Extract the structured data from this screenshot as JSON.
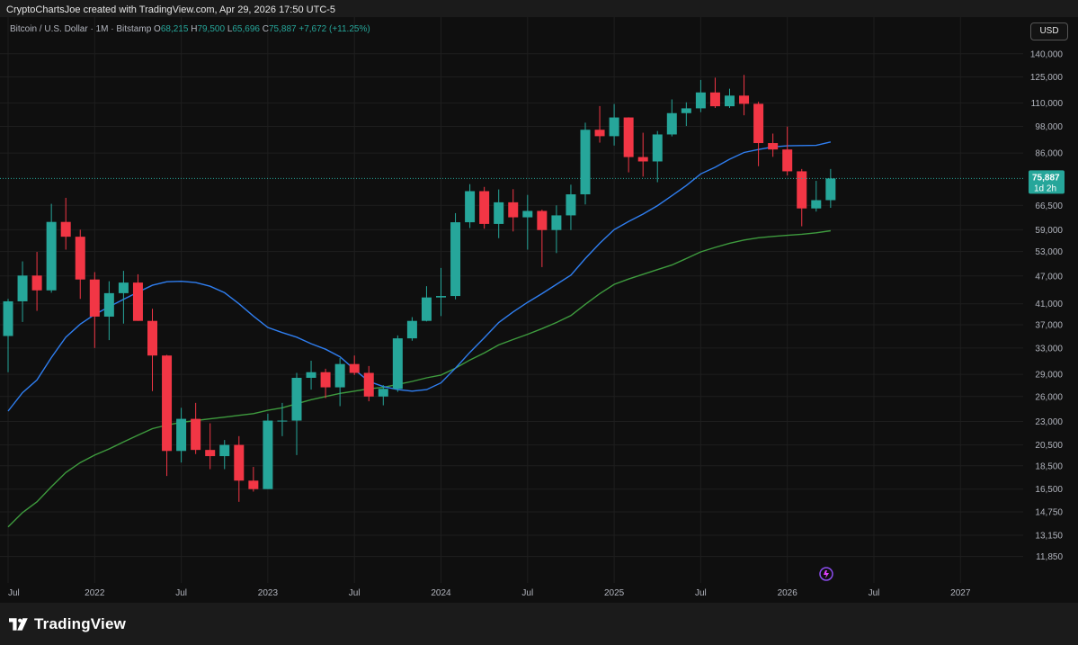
{
  "header": {
    "attribution": "CryptoChartsJoe created with TradingView.com, Apr 29, 2026 17:50 UTC-5"
  },
  "legend": {
    "symbol": "Bitcoin / U.S. Dollar · 1M · Bitstamp",
    "o_label": "O",
    "o_value": "68,215",
    "h_label": "H",
    "h_value": "79,500",
    "l_label": "L",
    "l_value": "65,696",
    "c_label": "C",
    "c_value": "75,887",
    "change": "+7,672 (+11.25%)"
  },
  "currency_button": "USD",
  "price_tag": {
    "value": "75,887",
    "countdown": "1d 2h"
  },
  "footer": {
    "brand": "TradingView"
  },
  "colors": {
    "up": "#26a69a",
    "down": "#f23645",
    "ma_fast": "#2f7ef0",
    "ma_slow": "#3e9b3e",
    "background": "#0f0f0f"
  },
  "chart_data": {
    "type": "candlestick",
    "scale": "log",
    "y_ticks": [
      11850,
      13150,
      14750,
      16500,
      18500,
      20500,
      23000,
      26000,
      29000,
      33000,
      37000,
      41000,
      47000,
      53000,
      59000,
      66500,
      75887,
      86000,
      98000,
      110000,
      125000,
      140000
    ],
    "y_tick_labels": [
      "11,850",
      "13,150",
      "14,750",
      "16,500",
      "18,500",
      "20,500",
      "23,000",
      "26,000",
      "29,000",
      "33,000",
      "37,000",
      "41,000",
      "47,000",
      "53,000",
      "59,000",
      "66,500",
      "75,887",
      "86,000",
      "98,000",
      "110,000",
      "125,000",
      "140,000"
    ],
    "x_ticks": [
      {
        "label": "Jul",
        "month": "2021-07"
      },
      {
        "label": "2022",
        "month": "2022-01"
      },
      {
        "label": "Jul",
        "month": "2022-07"
      },
      {
        "label": "2023",
        "month": "2023-01"
      },
      {
        "label": "Jul",
        "month": "2023-07"
      },
      {
        "label": "2024",
        "month": "2024-01"
      },
      {
        "label": "Jul",
        "month": "2024-07"
      },
      {
        "label": "2025",
        "month": "2025-01"
      },
      {
        "label": "Jul",
        "month": "2025-07"
      },
      {
        "label": "2026",
        "month": "2026-01"
      },
      {
        "label": "Jul",
        "month": "2026-07"
      },
      {
        "label": "2027",
        "month": "2027-01"
      }
    ],
    "candles": [
      {
        "month": "2021-07",
        "o": 35000,
        "h": 42000,
        "l": 29300,
        "c": 41500
      },
      {
        "month": "2021-08",
        "o": 41500,
        "h": 50500,
        "l": 37500,
        "c": 47100
      },
      {
        "month": "2021-09",
        "o": 47100,
        "h": 52900,
        "l": 39600,
        "c": 43800
      },
      {
        "month": "2021-10",
        "o": 43800,
        "h": 67000,
        "l": 43300,
        "c": 61300
      },
      {
        "month": "2021-11",
        "o": 61300,
        "h": 69000,
        "l": 53500,
        "c": 57000
      },
      {
        "month": "2021-12",
        "o": 57000,
        "h": 59000,
        "l": 42000,
        "c": 46200
      },
      {
        "month": "2022-01",
        "o": 46200,
        "h": 47900,
        "l": 33000,
        "c": 38500
      },
      {
        "month": "2022-02",
        "o": 38500,
        "h": 45800,
        "l": 34300,
        "c": 43200
      },
      {
        "month": "2022-03",
        "o": 43200,
        "h": 48200,
        "l": 37200,
        "c": 45500
      },
      {
        "month": "2022-04",
        "o": 45500,
        "h": 47400,
        "l": 37700,
        "c": 37700
      },
      {
        "month": "2022-05",
        "o": 37700,
        "h": 40000,
        "l": 26700,
        "c": 31800
      },
      {
        "month": "2022-06",
        "o": 31800,
        "h": 31900,
        "l": 17600,
        "c": 19900
      },
      {
        "month": "2022-07",
        "o": 19900,
        "h": 24600,
        "l": 18800,
        "c": 23300
      },
      {
        "month": "2022-08",
        "o": 23300,
        "h": 25200,
        "l": 19600,
        "c": 20000
      },
      {
        "month": "2022-09",
        "o": 20000,
        "h": 22800,
        "l": 18200,
        "c": 19400
      },
      {
        "month": "2022-10",
        "o": 19400,
        "h": 21000,
        "l": 18200,
        "c": 20500
      },
      {
        "month": "2022-11",
        "o": 20500,
        "h": 21400,
        "l": 15500,
        "c": 17200
      },
      {
        "month": "2022-12",
        "o": 17200,
        "h": 18400,
        "l": 16300,
        "c": 16500
      },
      {
        "month": "2023-01",
        "o": 16500,
        "h": 23900,
        "l": 16500,
        "c": 23100
      },
      {
        "month": "2023-02",
        "o": 23100,
        "h": 25200,
        "l": 21400,
        "c": 23100
      },
      {
        "month": "2023-03",
        "o": 23100,
        "h": 29200,
        "l": 19500,
        "c": 28500
      },
      {
        "month": "2023-04",
        "o": 28500,
        "h": 31000,
        "l": 26900,
        "c": 29300
      },
      {
        "month": "2023-05",
        "o": 29300,
        "h": 29800,
        "l": 25800,
        "c": 27200
      },
      {
        "month": "2023-06",
        "o": 27200,
        "h": 31400,
        "l": 24800,
        "c": 30500
      },
      {
        "month": "2023-07",
        "o": 30500,
        "h": 31800,
        "l": 28900,
        "c": 29200
      },
      {
        "month": "2023-08",
        "o": 29200,
        "h": 30200,
        "l": 25400,
        "c": 26000
      },
      {
        "month": "2023-09",
        "o": 26000,
        "h": 27500,
        "l": 24900,
        "c": 27000
      },
      {
        "month": "2023-10",
        "o": 27000,
        "h": 35100,
        "l": 26600,
        "c": 34600
      },
      {
        "month": "2023-11",
        "o": 34600,
        "h": 38400,
        "l": 34200,
        "c": 37700
      },
      {
        "month": "2023-12",
        "o": 37700,
        "h": 44700,
        "l": 37600,
        "c": 42300
      },
      {
        "month": "2024-01",
        "o": 42300,
        "h": 48900,
        "l": 38600,
        "c": 42600
      },
      {
        "month": "2024-02",
        "o": 42600,
        "h": 64000,
        "l": 41900,
        "c": 61200
      },
      {
        "month": "2024-03",
        "o": 61200,
        "h": 73800,
        "l": 59500,
        "c": 71300
      },
      {
        "month": "2024-04",
        "o": 71300,
        "h": 72800,
        "l": 59300,
        "c": 60700
      },
      {
        "month": "2024-05",
        "o": 60700,
        "h": 71900,
        "l": 56600,
        "c": 67500
      },
      {
        "month": "2024-06",
        "o": 67500,
        "h": 72000,
        "l": 58500,
        "c": 62700
      },
      {
        "month": "2024-07",
        "o": 62700,
        "h": 70000,
        "l": 53500,
        "c": 64700
      },
      {
        "month": "2024-08",
        "o": 64700,
        "h": 65100,
        "l": 49100,
        "c": 58900
      },
      {
        "month": "2024-09",
        "o": 58900,
        "h": 66500,
        "l": 52600,
        "c": 63300
      },
      {
        "month": "2024-10",
        "o": 63300,
        "h": 73600,
        "l": 58900,
        "c": 70200
      },
      {
        "month": "2024-11",
        "o": 70200,
        "h": 99800,
        "l": 66800,
        "c": 96400
      },
      {
        "month": "2024-12",
        "o": 96400,
        "h": 108300,
        "l": 90500,
        "c": 93400
      },
      {
        "month": "2025-01",
        "o": 93400,
        "h": 109400,
        "l": 89200,
        "c": 102400
      },
      {
        "month": "2025-02",
        "o": 102400,
        "h": 102500,
        "l": 78200,
        "c": 84300
      },
      {
        "month": "2025-03",
        "o": 84300,
        "h": 95000,
        "l": 76600,
        "c": 82500
      },
      {
        "month": "2025-04",
        "o": 82500,
        "h": 95800,
        "l": 74500,
        "c": 94200
      },
      {
        "month": "2025-05",
        "o": 94200,
        "h": 111900,
        "l": 93300,
        "c": 104600
      },
      {
        "month": "2025-06",
        "o": 104600,
        "h": 110300,
        "l": 98200,
        "c": 107100
      },
      {
        "month": "2025-07",
        "o": 107100,
        "h": 123100,
        "l": 105100,
        "c": 115800
      },
      {
        "month": "2025-08",
        "o": 115800,
        "h": 124500,
        "l": 107300,
        "c": 108200
      },
      {
        "month": "2025-09",
        "o": 108200,
        "h": 117900,
        "l": 107300,
        "c": 114000
      },
      {
        "month": "2025-10",
        "o": 114000,
        "h": 126200,
        "l": 103500,
        "c": 109500
      },
      {
        "month": "2025-11",
        "o": 109500,
        "h": 110600,
        "l": 80600,
        "c": 90300
      },
      {
        "month": "2025-12",
        "o": 90300,
        "h": 94600,
        "l": 84400,
        "c": 87500
      },
      {
        "month": "2026-01",
        "o": 87500,
        "h": 97900,
        "l": 77000,
        "c": 78600
      },
      {
        "month": "2026-02",
        "o": 78600,
        "h": 79500,
        "l": 60000,
        "c": 65500
      },
      {
        "month": "2026-03",
        "o": 65500,
        "h": 75000,
        "l": 64500,
        "c": 68215
      },
      {
        "month": "2026-04",
        "o": 68215,
        "h": 79500,
        "l": 65696,
        "c": 75887
      }
    ],
    "ma_fast": [
      {
        "month": "2021-07",
        "v": 24200
      },
      {
        "month": "2021-08",
        "v": 26500
      },
      {
        "month": "2021-09",
        "v": 28200
      },
      {
        "month": "2021-10",
        "v": 31500
      },
      {
        "month": "2021-11",
        "v": 34800
      },
      {
        "month": "2021-12",
        "v": 37100
      },
      {
        "month": "2022-01",
        "v": 38900
      },
      {
        "month": "2022-02",
        "v": 40400
      },
      {
        "month": "2022-03",
        "v": 41900
      },
      {
        "month": "2022-04",
        "v": 43400
      },
      {
        "month": "2022-05",
        "v": 44900
      },
      {
        "month": "2022-06",
        "v": 45700
      },
      {
        "month": "2022-07",
        "v": 45800
      },
      {
        "month": "2022-08",
        "v": 45500
      },
      {
        "month": "2022-09",
        "v": 44700
      },
      {
        "month": "2022-10",
        "v": 43300
      },
      {
        "month": "2022-11",
        "v": 41000
      },
      {
        "month": "2022-12",
        "v": 38600
      },
      {
        "month": "2023-01",
        "v": 36500
      },
      {
        "month": "2023-02",
        "v": 35600
      },
      {
        "month": "2023-03",
        "v": 34800
      },
      {
        "month": "2023-04",
        "v": 33700
      },
      {
        "month": "2023-05",
        "v": 32800
      },
      {
        "month": "2023-06",
        "v": 31600
      },
      {
        "month": "2023-07",
        "v": 29700
      },
      {
        "month": "2023-08",
        "v": 28000
      },
      {
        "month": "2023-09",
        "v": 27300
      },
      {
        "month": "2023-10",
        "v": 26900
      },
      {
        "month": "2023-11",
        "v": 26700
      },
      {
        "month": "2023-12",
        "v": 26900
      },
      {
        "month": "2024-01",
        "v": 27800
      },
      {
        "month": "2024-02",
        "v": 29900
      },
      {
        "month": "2024-03",
        "v": 32300
      },
      {
        "month": "2024-04",
        "v": 34700
      },
      {
        "month": "2024-05",
        "v": 37400
      },
      {
        "month": "2024-06",
        "v": 39400
      },
      {
        "month": "2024-07",
        "v": 41300
      },
      {
        "month": "2024-08",
        "v": 43100
      },
      {
        "month": "2024-09",
        "v": 45100
      },
      {
        "month": "2024-10",
        "v": 47200
      },
      {
        "month": "2024-11",
        "v": 51200
      },
      {
        "month": "2024-12",
        "v": 55200
      },
      {
        "month": "2025-01",
        "v": 59000
      },
      {
        "month": "2025-02",
        "v": 61400
      },
      {
        "month": "2025-03",
        "v": 63700
      },
      {
        "month": "2025-04",
        "v": 66400
      },
      {
        "month": "2025-05",
        "v": 69700
      },
      {
        "month": "2025-06",
        "v": 73300
      },
      {
        "month": "2025-07",
        "v": 77600
      },
      {
        "month": "2025-08",
        "v": 80200
      },
      {
        "month": "2025-09",
        "v": 83400
      },
      {
        "month": "2025-10",
        "v": 86200
      },
      {
        "month": "2025-11",
        "v": 87500
      },
      {
        "month": "2025-12",
        "v": 88600
      },
      {
        "month": "2026-01",
        "v": 89100
      },
      {
        "month": "2026-02",
        "v": 89200
      },
      {
        "month": "2026-03",
        "v": 89300
      },
      {
        "month": "2026-04",
        "v": 90800
      }
    ],
    "ma_slow": [
      {
        "month": "2021-07",
        "v": 13700
      },
      {
        "month": "2021-08",
        "v": 14700
      },
      {
        "month": "2021-09",
        "v": 15500
      },
      {
        "month": "2021-10",
        "v": 16700
      },
      {
        "month": "2021-11",
        "v": 17900
      },
      {
        "month": "2021-12",
        "v": 18800
      },
      {
        "month": "2022-01",
        "v": 19500
      },
      {
        "month": "2022-02",
        "v": 20100
      },
      {
        "month": "2022-03",
        "v": 20800
      },
      {
        "month": "2022-04",
        "v": 21500
      },
      {
        "month": "2022-05",
        "v": 22200
      },
      {
        "month": "2022-06",
        "v": 22600
      },
      {
        "month": "2022-07",
        "v": 22900
      },
      {
        "month": "2022-08",
        "v": 23100
      },
      {
        "month": "2022-09",
        "v": 23300
      },
      {
        "month": "2022-10",
        "v": 23500
      },
      {
        "month": "2022-11",
        "v": 23700
      },
      {
        "month": "2022-12",
        "v": 23900
      },
      {
        "month": "2023-01",
        "v": 24300
      },
      {
        "month": "2023-02",
        "v": 24600
      },
      {
        "month": "2023-03",
        "v": 25100
      },
      {
        "month": "2023-04",
        "v": 25600
      },
      {
        "month": "2023-05",
        "v": 26000
      },
      {
        "month": "2023-06",
        "v": 26400
      },
      {
        "month": "2023-07",
        "v": 26700
      },
      {
        "month": "2023-08",
        "v": 27000
      },
      {
        "month": "2023-09",
        "v": 27200
      },
      {
        "month": "2023-10",
        "v": 27600
      },
      {
        "month": "2023-11",
        "v": 28000
      },
      {
        "month": "2023-12",
        "v": 28500
      },
      {
        "month": "2024-01",
        "v": 28900
      },
      {
        "month": "2024-02",
        "v": 29900
      },
      {
        "month": "2024-03",
        "v": 31100
      },
      {
        "month": "2024-04",
        "v": 32200
      },
      {
        "month": "2024-05",
        "v": 33500
      },
      {
        "month": "2024-06",
        "v": 34400
      },
      {
        "month": "2024-07",
        "v": 35300
      },
      {
        "month": "2024-08",
        "v": 36300
      },
      {
        "month": "2024-09",
        "v": 37400
      },
      {
        "month": "2024-10",
        "v": 38700
      },
      {
        "month": "2024-11",
        "v": 40900
      },
      {
        "month": "2024-12",
        "v": 43100
      },
      {
        "month": "2025-01",
        "v": 45100
      },
      {
        "month": "2025-02",
        "v": 46300
      },
      {
        "month": "2025-03",
        "v": 47400
      },
      {
        "month": "2025-04",
        "v": 48500
      },
      {
        "month": "2025-05",
        "v": 49600
      },
      {
        "month": "2025-06",
        "v": 51200
      },
      {
        "month": "2025-07",
        "v": 52900
      },
      {
        "month": "2025-08",
        "v": 54100
      },
      {
        "month": "2025-09",
        "v": 55200
      },
      {
        "month": "2025-10",
        "v": 56100
      },
      {
        "month": "2025-11",
        "v": 56700
      },
      {
        "month": "2025-12",
        "v": 57100
      },
      {
        "month": "2026-01",
        "v": 57400
      },
      {
        "month": "2026-02",
        "v": 57700
      },
      {
        "month": "2026-03",
        "v": 58100
      },
      {
        "month": "2026-04",
        "v": 58700
      }
    ]
  }
}
